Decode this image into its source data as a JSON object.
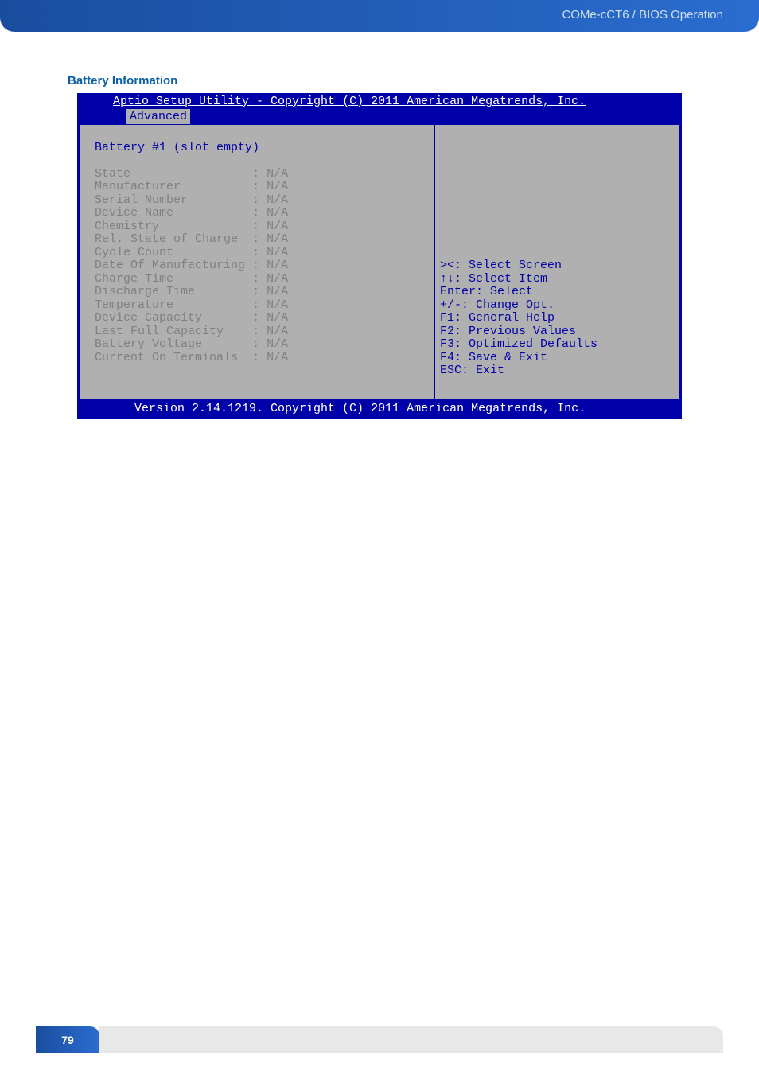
{
  "header": {
    "breadcrumb": "COMe-cCT6 / BIOS Operation"
  },
  "section_title": "Battery Information",
  "bios": {
    "title": "Aptio Setup Utility - Copyright (C) 2011 American Megatrends, Inc.",
    "tab_active": "Advanced",
    "left": {
      "pane_title": "Battery #1 (slot empty)",
      "rows": [
        {
          "label": "State",
          "value": "N/A"
        },
        {
          "label": "Manufacturer",
          "value": "N/A"
        },
        {
          "label": "Serial Number",
          "value": "N/A"
        },
        {
          "label": "Device Name",
          "value": "N/A"
        },
        {
          "label": "Chemistry",
          "value": "N/A"
        },
        {
          "label": "Rel. State of Charge",
          "value": "N/A"
        },
        {
          "label": "Cycle Count",
          "value": "N/A"
        },
        {
          "label": "Date Of Manufacturing",
          "value": "N/A"
        },
        {
          "label": "Charge Time",
          "value": "N/A"
        },
        {
          "label": "Discharge Time",
          "value": "N/A"
        },
        {
          "label": "Temperature",
          "value": "N/A"
        },
        {
          "label": "Device Capacity",
          "value": "N/A"
        },
        {
          "label": "Last Full Capacity",
          "value": "N/A"
        },
        {
          "label": "Battery Voltage",
          "value": "N/A"
        },
        {
          "label": "Current On Terminals",
          "value": "N/A"
        }
      ]
    },
    "help": [
      "><: Select Screen",
      "↑↓: Select Item",
      "Enter: Select",
      "+/-: Change Opt.",
      "F1: General Help",
      "F2: Previous Values",
      "F3: Optimized Defaults",
      "F4: Save & Exit",
      "ESC: Exit"
    ],
    "footer": "Version 2.14.1219. Copyright (C) 2011 American Megatrends, Inc."
  },
  "page_number": "79"
}
